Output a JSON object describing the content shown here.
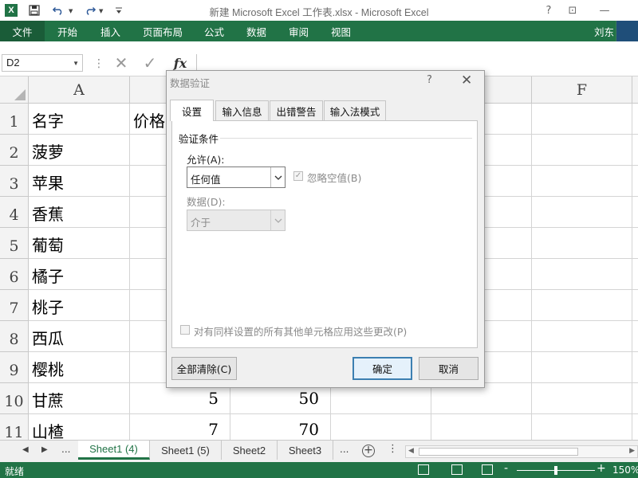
{
  "window": {
    "title": "新建 Microsoft Excel 工作表.xlsx - Microsoft Excel",
    "app_logo_letter": "X",
    "help_glyph": "?",
    "restore_glyph": "⊡",
    "minimize_glyph": "—",
    "user": "刘东"
  },
  "ribbon": {
    "file_tab": "文件",
    "tabs": [
      "开始",
      "插入",
      "页面布局",
      "公式",
      "数据",
      "审阅",
      "视图"
    ]
  },
  "formula_bar": {
    "name_box": "D2",
    "cancel_glyph": "✕",
    "enter_glyph": "✓",
    "fx_label": "fx",
    "formula": ""
  },
  "grid": {
    "columns": [
      "A",
      "",
      "",
      "",
      "",
      "F"
    ],
    "rows": [
      "1",
      "2",
      "3",
      "4",
      "5",
      "6",
      "7",
      "8",
      "9",
      "10",
      "11"
    ],
    "col_a": [
      "名字",
      "菠萝",
      "苹果",
      "香蕉",
      "葡萄",
      "橘子",
      "桃子",
      "西瓜",
      "樱桃",
      "甘蔗",
      "山楂"
    ],
    "col_b_header": "价格",
    "col_b_values": [
      "5",
      "7"
    ],
    "col_c_values": [
      "50",
      "70"
    ]
  },
  "sheet_tabs": {
    "ellipsis": "...",
    "tabs": [
      "Sheet1 (4)",
      "Sheet1 (5)",
      "Sheet2",
      "Sheet3"
    ],
    "active_index": 0,
    "add_glyph": "+"
  },
  "status_bar": {
    "ready": "就绪",
    "zoom_minus": "-",
    "zoom_plus": "+",
    "zoom": "150%",
    "zoom_fraction": 0.5
  },
  "dialog": {
    "title": "数据验证",
    "help": "?",
    "close": "✕",
    "tabs": [
      "设置",
      "输入信息",
      "出错警告",
      "输入法模式"
    ],
    "active_tab": 0,
    "group_label": "验证条件",
    "allow_label": "允许(A):",
    "allow_value": "任何值",
    "ignore_blank_label": "忽略空值(B)",
    "ignore_blank_checked": true,
    "data_label": "数据(D):",
    "data_value": "介于",
    "apply_all_label": "对有同样设置的所有其他单元格应用这些更改(P)",
    "clear_all": "全部清除(C)",
    "ok": "确定",
    "cancel": "取消"
  },
  "colors": {
    "excel_green": "#217346",
    "dialog_bg": "#f0f0f0",
    "primary_button_border": "#3c7fb1"
  }
}
